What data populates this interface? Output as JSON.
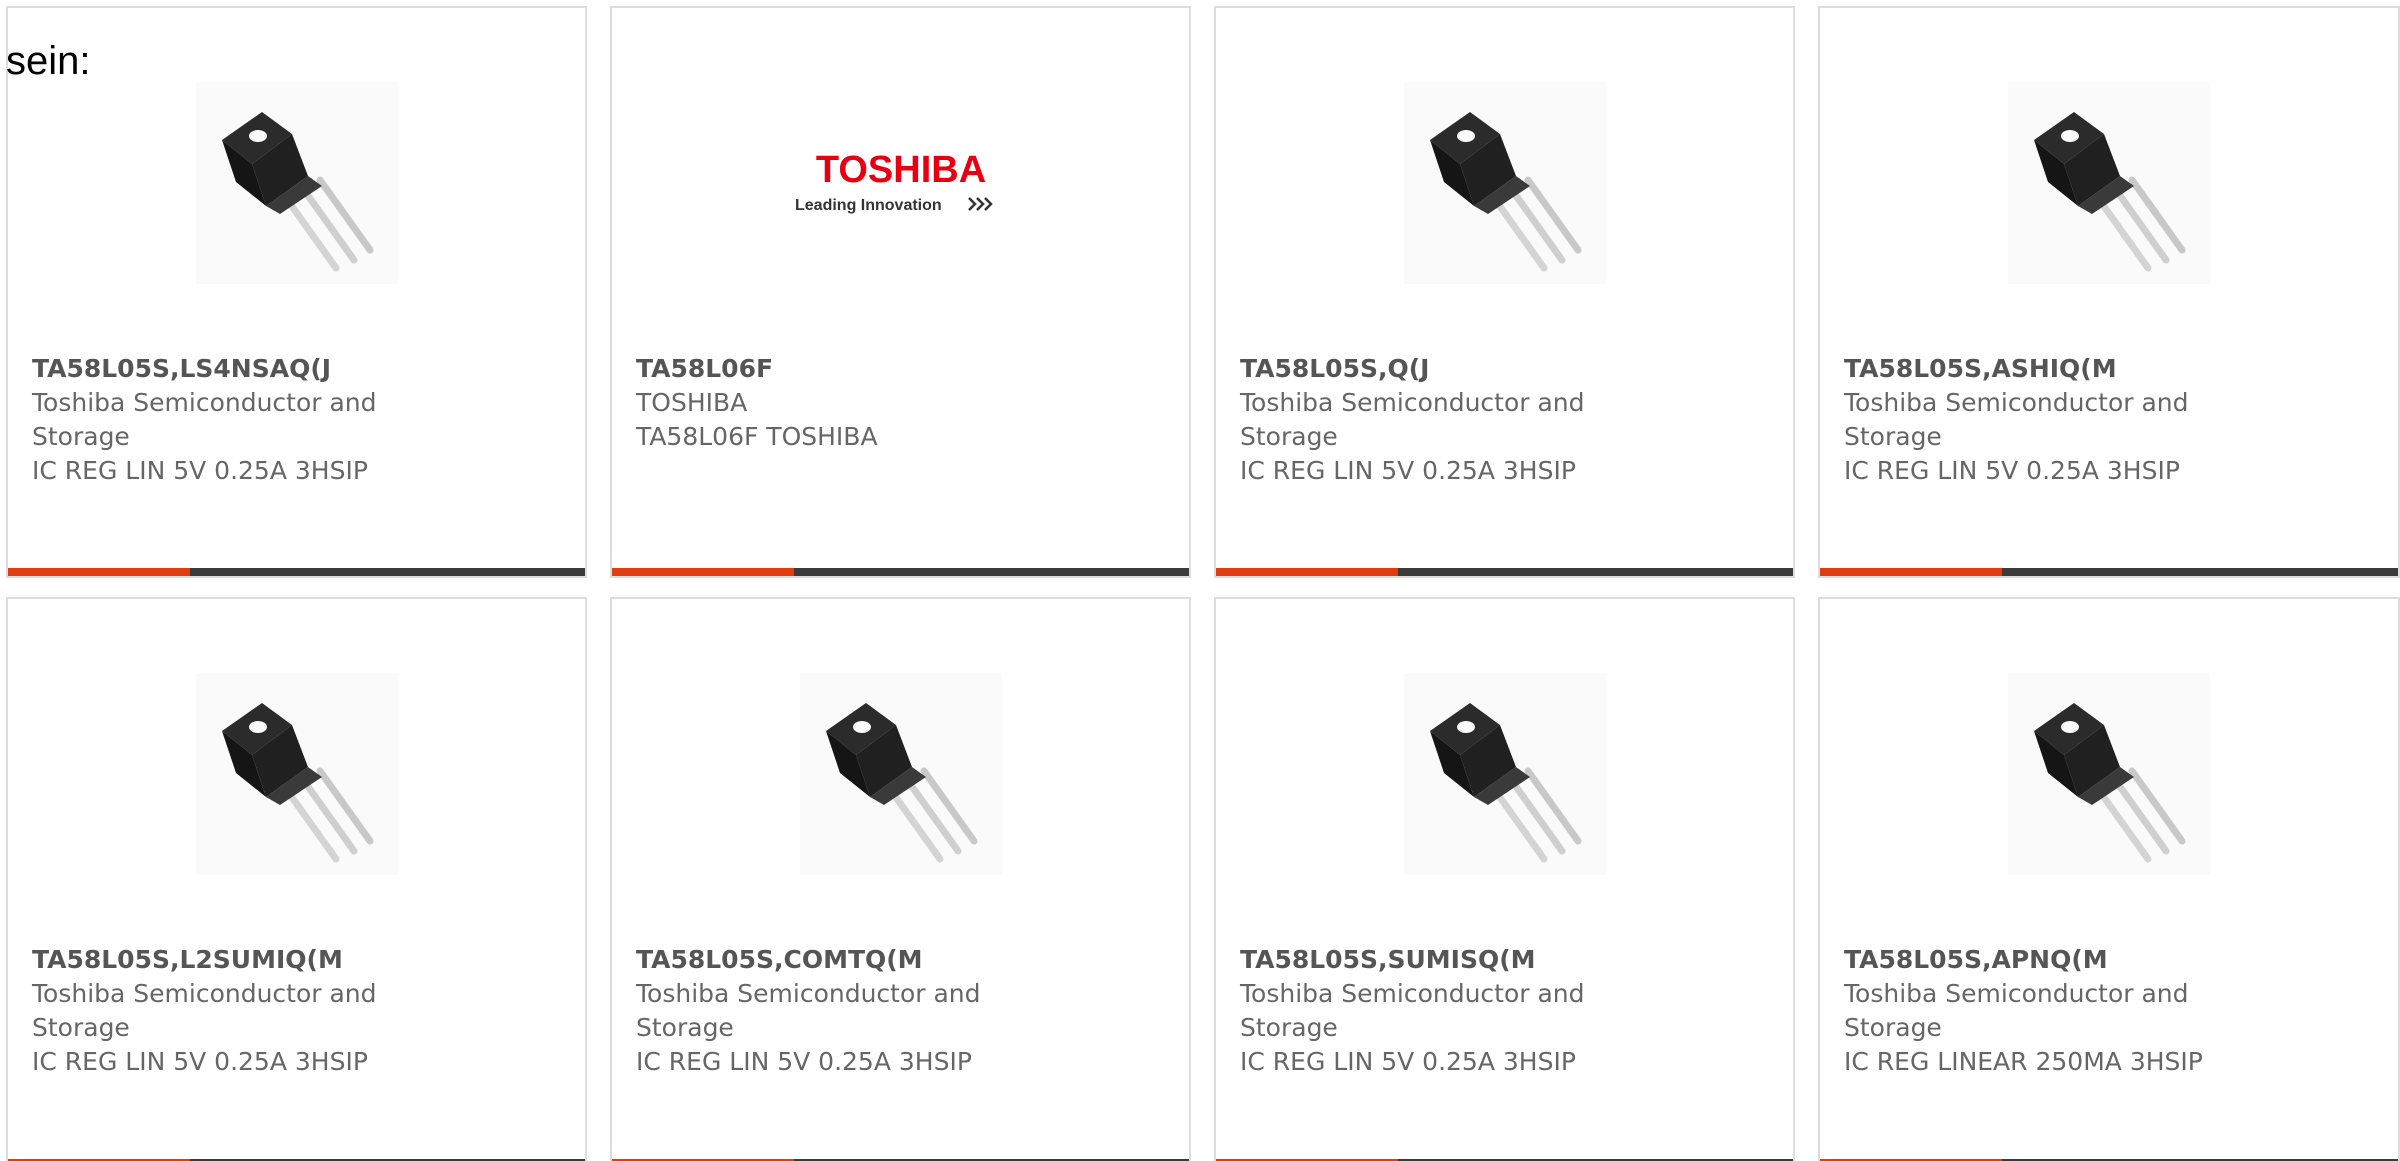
{
  "page": {
    "intro_text": "sein:"
  },
  "colors": {
    "accent": "#e03c10",
    "bar": "#3b3b3b",
    "border": "#dddddd",
    "text": "#666666",
    "toshiba_red": "#e60012"
  },
  "toshiba_logo": {
    "wordmark": "TOSHIBA",
    "tagline": "Leading Innovation"
  },
  "products": [
    {
      "part": "TA58L05S,LS4NSAQ(J",
      "maker_line1": "Toshiba Semiconductor and",
      "maker_line2": "Storage",
      "description": "IC REG LIN 5V 0.25A 3HSIP",
      "image": "transistor-package-icon"
    },
    {
      "part": "TA58L06F",
      "maker_line1": "TOSHIBA",
      "maker_line2": "",
      "description": "TA58L06F TOSHIBA",
      "image": "toshiba-logo"
    },
    {
      "part": "TA58L05S,Q(J",
      "maker_line1": "Toshiba Semiconductor and",
      "maker_line2": "Storage",
      "description": "IC REG LIN 5V 0.25A 3HSIP",
      "image": "transistor-package-icon"
    },
    {
      "part": "TA58L05S,ASHIQ(M",
      "maker_line1": "Toshiba Semiconductor and",
      "maker_line2": "Storage",
      "description": "IC REG LIN 5V 0.25A 3HSIP",
      "image": "transistor-package-icon"
    },
    {
      "part": "TA58L05S,L2SUMIQ(M",
      "maker_line1": "Toshiba Semiconductor and",
      "maker_line2": "Storage",
      "description": "IC REG LIN 5V 0.25A 3HSIP",
      "image": "transistor-package-icon"
    },
    {
      "part": "TA58L05S,COMTQ(M",
      "maker_line1": "Toshiba Semiconductor and",
      "maker_line2": "Storage",
      "description": "IC REG LIN 5V 0.25A 3HSIP",
      "image": "transistor-package-icon"
    },
    {
      "part": "TA58L05S,SUMISQ(M",
      "maker_line1": "Toshiba Semiconductor and",
      "maker_line2": "Storage",
      "description": "IC REG LIN 5V 0.25A 3HSIP",
      "image": "transistor-package-icon"
    },
    {
      "part": "TA58L05S,APNQ(M",
      "maker_line1": "Toshiba Semiconductor and",
      "maker_line2": "Storage",
      "description": "IC REG LINEAR 250MA 3HSIP",
      "image": "transistor-package-icon"
    }
  ]
}
